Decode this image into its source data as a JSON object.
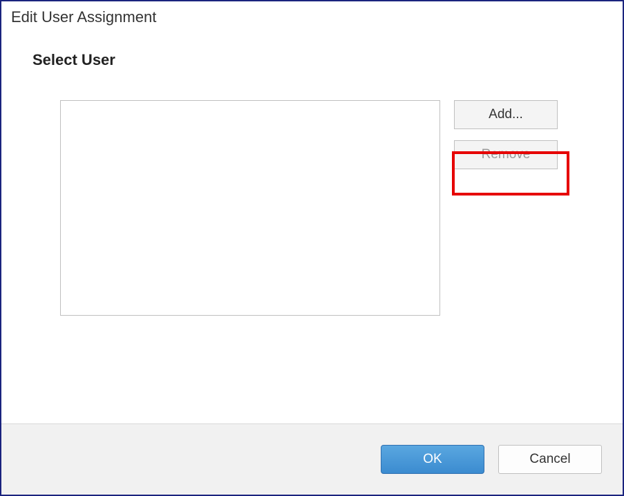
{
  "dialog": {
    "title": "Edit User Assignment",
    "section_heading": "Select User"
  },
  "buttons": {
    "add": "Add...",
    "remove": "Remove",
    "ok": "OK",
    "cancel": "Cancel"
  },
  "state": {
    "remove_enabled": false,
    "add_highlighted": true
  },
  "userlist": {
    "items": []
  }
}
